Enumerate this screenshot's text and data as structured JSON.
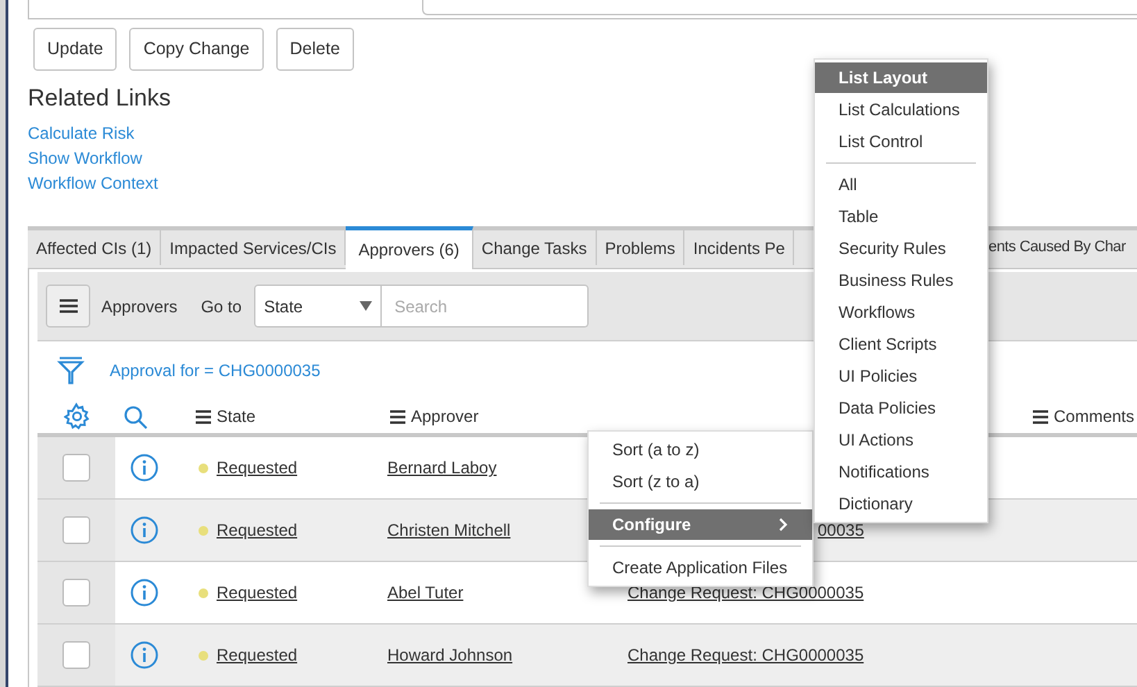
{
  "form_buttons": [
    "Update",
    "Copy Change",
    "Delete"
  ],
  "related_links": {
    "title": "Related Links",
    "links": [
      "Calculate Risk",
      "Show Workflow",
      "Workflow Context"
    ]
  },
  "tabs": [
    {
      "label": "Affected CIs (1)",
      "selected": false
    },
    {
      "label": "Impacted Services/CIs",
      "selected": false
    },
    {
      "label": "Approvers (6)",
      "selected": true
    },
    {
      "label": "Change Tasks",
      "selected": false
    },
    {
      "label": "Problems",
      "selected": false
    },
    {
      "label": "Incidents Pe",
      "selected": false
    },
    {
      "label": "ents Caused By Char",
      "selected": false
    }
  ],
  "list_toolbar": {
    "title": "Approvers",
    "goto_label": "Go to",
    "field": "State",
    "search": {
      "placeholder": "Search"
    }
  },
  "filter": "Approval for = CHG0000035",
  "columns": [
    {
      "label": "State"
    },
    {
      "label": "Approver"
    },
    {
      "label": "Comments"
    }
  ],
  "rows": [
    {
      "checked": false,
      "state": "Requested",
      "approver": "Bernard Laboy"
    },
    {
      "checked": false,
      "state": "Requested",
      "approver": "Christen Mitchell",
      "column_3": "00035"
    },
    {
      "checked": false,
      "state": "Requested",
      "approver": "Abel Tuter",
      "column_3": "Change Request: CHG0000035"
    },
    {
      "checked": false,
      "state": "Requested",
      "approver": "Howard Johnson",
      "column_3": "Change Request: CHG0000035"
    }
  ],
  "context_menu": {
    "groups": [
      [
        {
          "label": "Sort (a to z)",
          "selected": false
        },
        {
          "label": "Sort (z to a)",
          "selected": false
        }
      ],
      [
        {
          "label": "Configure",
          "selected": true,
          "submenu": true
        }
      ],
      [
        {
          "label": "Create Application Files",
          "selected": false
        }
      ]
    ]
  },
  "submenu": {
    "groups": [
      [
        {
          "label": "List Layout",
          "selected": true
        },
        {
          "label": "List Calculations",
          "selected": false
        },
        {
          "label": "List Control",
          "selected": false
        }
      ],
      [
        {
          "label": "All",
          "selected": false
        },
        {
          "label": "Table",
          "selected": false
        },
        {
          "label": "Security Rules",
          "selected": false
        },
        {
          "label": "Business Rules",
          "selected": false
        },
        {
          "label": "Workflows",
          "selected": false
        },
        {
          "label": "Client Scripts",
          "selected": false
        },
        {
          "label": "UI Policies",
          "selected": false
        },
        {
          "label": "Data Policies",
          "selected": false
        },
        {
          "label": "UI Actions",
          "selected": false
        },
        {
          "label": "Notifications",
          "selected": false
        },
        {
          "label": "Dictionary",
          "selected": false
        }
      ]
    ]
  }
}
